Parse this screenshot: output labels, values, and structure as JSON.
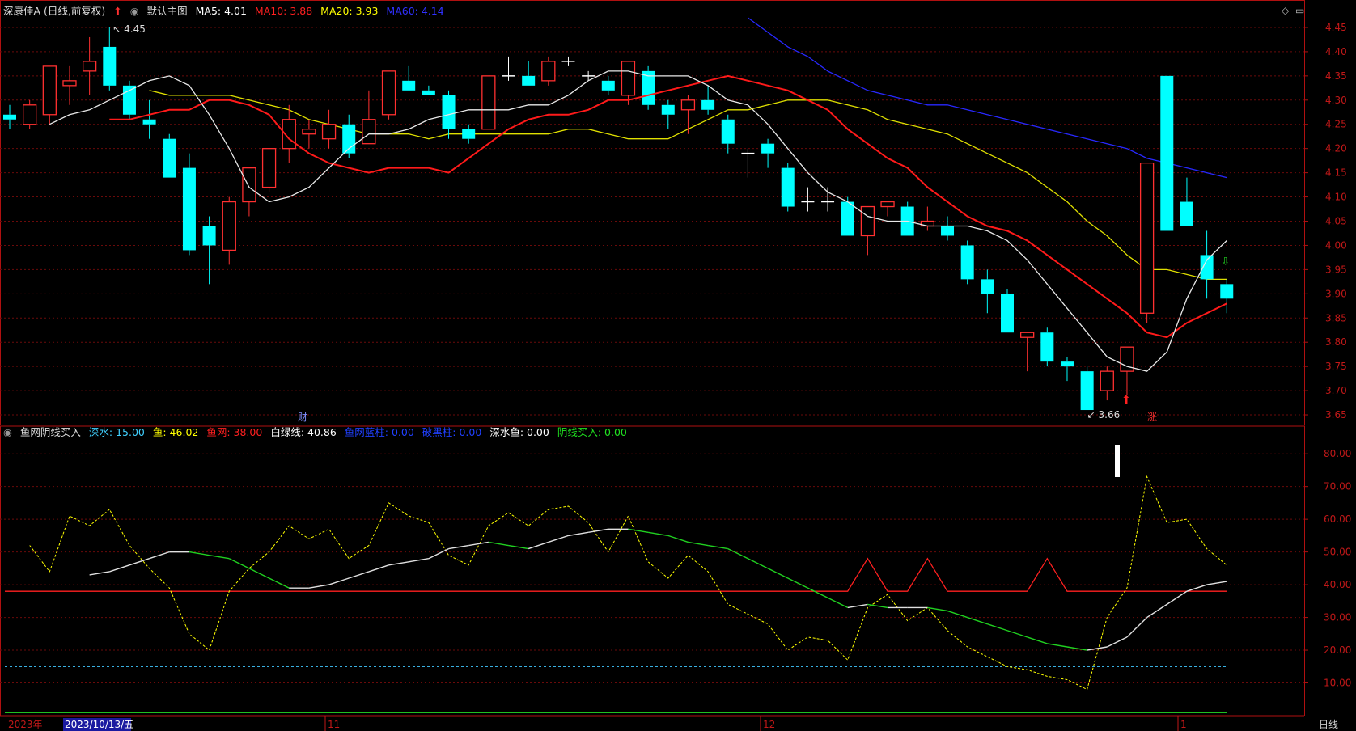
{
  "header": {
    "stock_name": "深康佳A (日线,前复权)",
    "template": "默认主图",
    "ma_items": [
      {
        "label": "MA5: 4.01",
        "color": "#ffffff"
      },
      {
        "label": "MA10: 3.88",
        "color": "#ff2020"
      },
      {
        "label": "MA20: 3.93",
        "color": "#ffff00"
      },
      {
        "label": "MA60: 4.14",
        "color": "#2020ff"
      }
    ]
  },
  "indicator_header": {
    "name": "鱼网阴线买入",
    "items": [
      {
        "label": "深水: 15.00",
        "color": "#40d0ff"
      },
      {
        "label": "鱼: 46.02",
        "color": "#ffff00"
      },
      {
        "label": "鱼网: 38.00",
        "color": "#ff2020"
      },
      {
        "label": "白绿线: 40.86",
        "color": "#ffffff"
      },
      {
        "label": "鱼网蓝柱: 0.00",
        "color": "#2040ff"
      },
      {
        "label": "破黑柱: 0.00",
        "color": "#2040ff"
      },
      {
        "label": "深水鱼: 0.00",
        "color": "#ffffff"
      },
      {
        "label": "阴线买入: 0.00",
        "color": "#20e020"
      }
    ]
  },
  "bottom": {
    "year": "2023年",
    "cursor_date": "2023/10/13/五",
    "period": "日线",
    "month_labels": [
      "11",
      "12",
      "1"
    ]
  },
  "markers": {
    "high_label": "4.45",
    "low_label": "3.66",
    "fin_label": "财",
    "rise_label": "涨"
  },
  "chart_data": [
    {
      "type": "candlestick",
      "yaxis_ticks": [
        3.65,
        3.7,
        3.75,
        3.8,
        3.85,
        3.9,
        3.95,
        4.0,
        4.05,
        4.1,
        4.15,
        4.2,
        4.25,
        4.3,
        4.35,
        4.4,
        4.45
      ],
      "ylim": [
        3.63,
        4.47
      ],
      "ohlc": [
        [
          4.27,
          4.29,
          4.24,
          4.26
        ],
        [
          4.25,
          4.3,
          4.24,
          4.29
        ],
        [
          4.27,
          4.37,
          4.25,
          4.37
        ],
        [
          4.33,
          4.37,
          4.29,
          4.34
        ],
        [
          4.36,
          4.43,
          4.31,
          4.38
        ],
        [
          4.41,
          4.45,
          4.32,
          4.33
        ],
        [
          4.33,
          4.34,
          4.26,
          4.27
        ],
        [
          4.26,
          4.3,
          4.22,
          4.25
        ],
        [
          4.22,
          4.23,
          4.14,
          4.14
        ],
        [
          4.16,
          4.19,
          3.98,
          3.99
        ],
        [
          4.04,
          4.06,
          3.92,
          4.0
        ],
        [
          3.99,
          4.1,
          3.96,
          4.09
        ],
        [
          4.09,
          4.16,
          4.06,
          4.16
        ],
        [
          4.12,
          4.2,
          4.11,
          4.2
        ],
        [
          4.2,
          4.29,
          4.17,
          4.26
        ],
        [
          4.23,
          4.26,
          4.2,
          4.24
        ],
        [
          4.22,
          4.28,
          4.2,
          4.25
        ],
        [
          4.25,
          4.27,
          4.18,
          4.19
        ],
        [
          4.21,
          4.32,
          4.21,
          4.26
        ],
        [
          4.27,
          4.36,
          4.26,
          4.36
        ],
        [
          4.34,
          4.37,
          4.32,
          4.32
        ],
        [
          4.32,
          4.33,
          4.31,
          4.31
        ],
        [
          4.31,
          4.32,
          4.22,
          4.24
        ],
        [
          4.24,
          4.25,
          4.21,
          4.22
        ],
        [
          4.24,
          4.28,
          4.24,
          4.35
        ],
        [
          4.35,
          4.39,
          4.34,
          4.35
        ],
        [
          4.35,
          4.38,
          4.33,
          4.33
        ],
        [
          4.34,
          4.39,
          4.33,
          4.38
        ],
        [
          4.38,
          4.39,
          4.37,
          4.38
        ],
        [
          4.35,
          4.36,
          4.34,
          4.35
        ],
        [
          4.34,
          4.35,
          4.31,
          4.32
        ],
        [
          4.31,
          4.38,
          4.29,
          4.38
        ],
        [
          4.36,
          4.37,
          4.28,
          4.29
        ],
        [
          4.29,
          4.3,
          4.24,
          4.27
        ],
        [
          4.28,
          4.31,
          4.23,
          4.3
        ],
        [
          4.3,
          4.33,
          4.27,
          4.28
        ],
        [
          4.26,
          4.27,
          4.19,
          4.21
        ],
        [
          4.19,
          4.2,
          4.14,
          4.19
        ],
        [
          4.21,
          4.22,
          4.16,
          4.19
        ],
        [
          4.16,
          4.17,
          4.07,
          4.08
        ],
        [
          4.09,
          4.12,
          4.07,
          4.09
        ],
        [
          4.09,
          4.12,
          4.07,
          4.09
        ],
        [
          4.09,
          4.1,
          4.02,
          4.02
        ],
        [
          4.02,
          4.07,
          3.98,
          4.08
        ],
        [
          4.08,
          4.09,
          4.06,
          4.09
        ],
        [
          4.08,
          4.09,
          4.02,
          4.02
        ],
        [
          4.04,
          4.08,
          4.03,
          4.05
        ],
        [
          4.04,
          4.06,
          4.01,
          4.02
        ],
        [
          4.0,
          4.01,
          3.92,
          3.93
        ],
        [
          3.93,
          3.95,
          3.86,
          3.9
        ],
        [
          3.9,
          3.91,
          3.82,
          3.82
        ],
        [
          3.81,
          3.82,
          3.74,
          3.82
        ],
        [
          3.82,
          3.83,
          3.75,
          3.76
        ],
        [
          3.76,
          3.77,
          3.72,
          3.75
        ],
        [
          3.74,
          3.75,
          3.66,
          3.66
        ],
        [
          3.7,
          3.75,
          3.68,
          3.74
        ],
        [
          3.74,
          3.79,
          3.69,
          3.79
        ],
        [
          3.86,
          4.17,
          3.84,
          4.17
        ],
        [
          4.35,
          4.35,
          4.03,
          4.03
        ],
        [
          4.09,
          4.14,
          4.04,
          4.04
        ],
        [
          3.98,
          4.03,
          3.89,
          3.93
        ],
        [
          3.92,
          3.93,
          3.86,
          3.89
        ]
      ],
      "ma5": [
        4.25,
        4.27,
        4.28,
        4.3,
        4.32,
        4.34,
        4.35,
        4.33,
        4.27,
        4.2,
        4.12,
        4.09,
        4.1,
        4.12,
        4.16,
        4.2,
        4.23,
        4.23,
        4.24,
        4.26,
        4.27,
        4.28,
        4.28,
        4.28,
        4.29,
        4.29,
        4.31,
        4.34,
        4.36,
        4.36,
        4.35,
        4.35,
        4.35,
        4.33,
        4.3,
        4.29,
        4.25,
        4.2,
        4.15,
        4.11,
        4.09,
        4.06,
        4.05,
        4.05,
        4.04,
        4.04,
        4.04,
        4.03,
        4.01,
        3.97,
        3.92,
        3.87,
        3.82,
        3.77,
        3.75,
        3.74,
        3.78,
        3.89,
        3.97,
        4.01
      ],
      "ma10": [
        4.26,
        4.26,
        4.27,
        4.28,
        4.28,
        4.3,
        4.3,
        4.29,
        4.27,
        4.22,
        4.19,
        4.17,
        4.16,
        4.15,
        4.16,
        4.16,
        4.16,
        4.15,
        4.18,
        4.21,
        4.24,
        4.26,
        4.27,
        4.27,
        4.28,
        4.3,
        4.3,
        4.31,
        4.32,
        4.33,
        4.34,
        4.35,
        4.34,
        4.33,
        4.32,
        4.3,
        4.28,
        4.24,
        4.21,
        4.18,
        4.16,
        4.12,
        4.09,
        4.06,
        4.04,
        4.03,
        4.01,
        3.98,
        3.95,
        3.92,
        3.89,
        3.86,
        3.82,
        3.81,
        3.84,
        3.86,
        3.88
      ],
      "ma20": [
        4.32,
        4.31,
        4.31,
        4.31,
        4.31,
        4.3,
        4.29,
        4.28,
        4.26,
        4.25,
        4.24,
        4.23,
        4.23,
        4.23,
        4.22,
        4.23,
        4.23,
        4.23,
        4.23,
        4.23,
        4.23,
        4.24,
        4.24,
        4.23,
        4.22,
        4.22,
        4.22,
        4.24,
        4.26,
        4.28,
        4.28,
        4.29,
        4.3,
        4.3,
        4.3,
        4.29,
        4.28,
        4.26,
        4.25,
        4.24,
        4.23,
        4.21,
        4.19,
        4.17,
        4.15,
        4.12,
        4.09,
        4.05,
        4.02,
        3.98,
        3.95,
        3.95,
        3.94,
        3.93,
        3.93
      ],
      "ma60": [
        4.47,
        4.44,
        4.41,
        4.39,
        4.36,
        4.34,
        4.32,
        4.31,
        4.3,
        4.29,
        4.29,
        4.28,
        4.27,
        4.26,
        4.25,
        4.24,
        4.23,
        4.22,
        4.21,
        4.2,
        4.18,
        4.17,
        4.16,
        4.15,
        4.14
      ]
    },
    {
      "type": "line",
      "yaxis_ticks": [
        10.0,
        20.0,
        30.0,
        40.0,
        50.0,
        60.0,
        70.0,
        80.0
      ],
      "ylim": [
        0,
        84
      ],
      "series": [
        {
          "name": "深水",
          "values": [
            15
          ]
        },
        {
          "name": "鱼",
          "values": [
            52,
            44,
            61,
            58,
            63,
            52,
            45,
            39,
            25,
            20,
            38,
            45,
            50,
            58,
            54,
            57,
            48,
            52,
            65,
            61,
            59,
            49,
            46,
            58,
            62,
            58,
            63,
            64,
            59,
            50,
            61,
            47,
            42,
            49,
            44,
            34,
            31,
            28,
            20,
            24,
            23,
            17,
            33,
            37,
            29,
            33,
            26,
            21,
            18,
            15,
            14,
            12,
            11,
            8,
            30,
            39,
            73,
            59,
            60,
            51,
            46
          ]
        },
        {
          "name": "白绿线",
          "values": [
            43,
            44,
            46,
            48,
            50,
            50,
            49,
            48,
            45,
            42,
            39,
            39,
            40,
            42,
            44,
            46,
            47,
            48,
            51,
            52,
            53,
            52,
            51,
            53,
            55,
            56,
            57,
            57,
            56,
            55,
            53,
            52,
            51,
            48,
            45,
            42,
            39,
            36,
            33,
            34,
            33,
            33,
            33,
            32,
            30,
            28,
            26,
            24,
            22,
            21,
            20,
            21,
            24,
            30,
            34,
            38,
            40,
            41
          ]
        },
        {
          "name": "鱼网",
          "values": [
            38
          ]
        }
      ]
    }
  ]
}
